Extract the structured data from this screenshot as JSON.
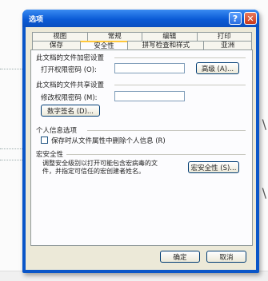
{
  "window": {
    "title": "选项",
    "help_glyph": "?",
    "close_glyph": "✕"
  },
  "tabs_back": [
    "视图",
    "常规",
    "编辑",
    "打印"
  ],
  "tabs_front": [
    "保存",
    "安全性",
    "拼写检查和样式",
    "亚洲"
  ],
  "active_tab": "安全性",
  "encrypt": {
    "section": "此文档的文件加密设置",
    "open_password_label": "打开权限密码 (O):",
    "open_password_value": "",
    "advanced_button": "高级 (A)..."
  },
  "share": {
    "section": "此文档的文件共享设置",
    "modify_password_label": "修改权限密码 (M):",
    "modify_password_value": "",
    "digital_signature_button": "数字签名 (D)..."
  },
  "privacy": {
    "section": "个人信息选项",
    "remove_personal_info_label": "保存时从文件属性中删除个人信息 (R)",
    "remove_personal_info_checked": false
  },
  "macro": {
    "section": "宏安全性",
    "note": "调整安全级别以打开可能包含宏病毒的文件，并指定可信任的宏创建者姓名。",
    "macro_security_button": "宏安全性 (S)..."
  },
  "footer": {
    "ok_label": "确定",
    "cancel_label": "取消"
  }
}
